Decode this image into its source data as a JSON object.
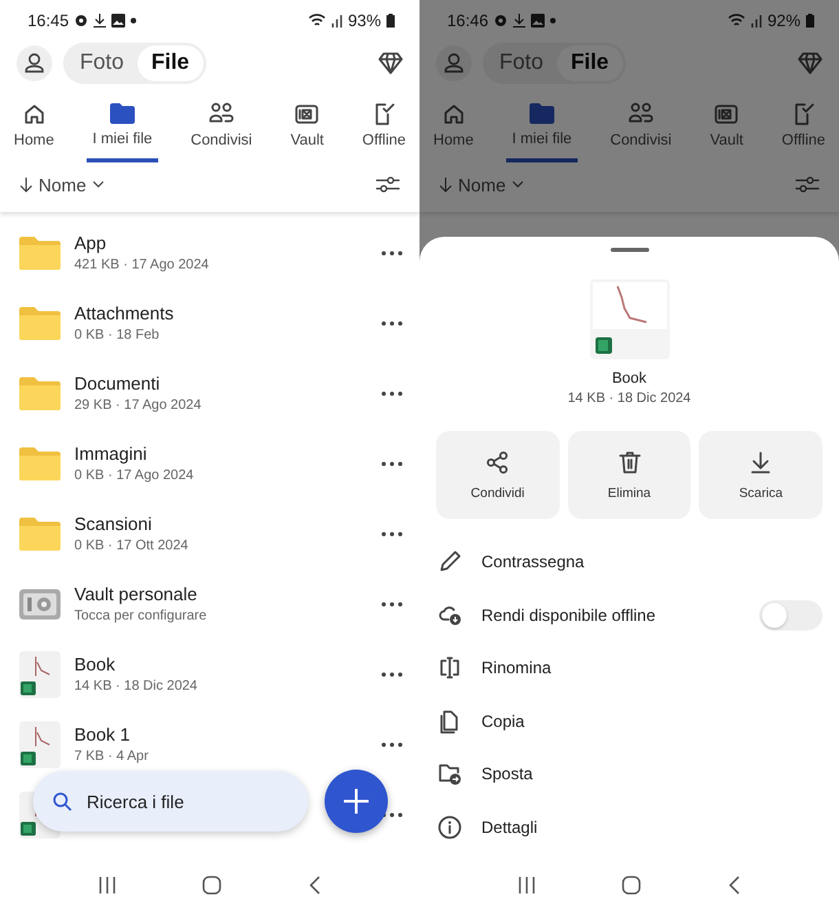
{
  "screens": [
    {
      "status": {
        "time": "16:45",
        "battery": "93%"
      },
      "segments": [
        {
          "label": "Foto",
          "selected": false
        },
        {
          "label": "File",
          "selected": true
        }
      ],
      "tabs": [
        {
          "label": "Home",
          "kind": "home",
          "selected": false
        },
        {
          "label": "I miei file",
          "kind": "folder",
          "selected": true
        },
        {
          "label": "Condivisi",
          "kind": "people",
          "selected": false
        },
        {
          "label": "Vault",
          "kind": "vault",
          "selected": false
        },
        {
          "label": "Offline",
          "kind": "offline",
          "selected": false
        }
      ],
      "sort": "Nome",
      "rows": [
        {
          "kind": "folder",
          "name": "App",
          "meta": "421 KB · 17 Ago 2024"
        },
        {
          "kind": "folder",
          "name": "Attachments",
          "meta": "0 KB · 18 Feb"
        },
        {
          "kind": "folder",
          "name": "Documenti",
          "meta": "29 KB · 17 Ago 2024"
        },
        {
          "kind": "folder",
          "name": "Immagini",
          "meta": "0 KB · 17 Ago 2024"
        },
        {
          "kind": "folder",
          "name": "Scansioni",
          "meta": "0 KB · 17 Ott 2024"
        },
        {
          "kind": "vault",
          "name": "Vault personale",
          "meta": "Tocca per configurare"
        },
        {
          "kind": "sheet",
          "name": "Book",
          "meta": "14 KB · 18 Dic 2024"
        },
        {
          "kind": "sheet",
          "name": "Book 1",
          "meta": "7 KB · 4 Apr"
        },
        {
          "kind": "sheet"
        }
      ],
      "search": {
        "placeholder": "Ricerca i file"
      }
    },
    {
      "status": {
        "time": "16:46",
        "battery": "92%"
      },
      "segments": [
        {
          "label": "Foto",
          "selected": false
        },
        {
          "label": "File",
          "selected": true
        }
      ],
      "tabs": [
        {
          "label": "Home",
          "kind": "home",
          "selected": false
        },
        {
          "label": "I miei file",
          "kind": "folder",
          "selected": true
        },
        {
          "label": "Condivisi",
          "kind": "people",
          "selected": false
        },
        {
          "label": "Vault",
          "kind": "vault",
          "selected": false
        },
        {
          "label": "Offline",
          "kind": "offline",
          "selected": false
        }
      ],
      "sort": "Nome",
      "sheet": {
        "name": "Book",
        "meta": "14 KB · 18 Dic 2024",
        "actions": [
          {
            "kind": "share",
            "label": "Condividi"
          },
          {
            "kind": "delete",
            "label": "Elimina"
          },
          {
            "kind": "download",
            "label": "Scarica"
          }
        ],
        "items": [
          {
            "kind": "flag",
            "label": "Contrassegna"
          },
          {
            "kind": "offline",
            "label": "Rendi disponibile offline",
            "on": false
          },
          {
            "kind": "rename",
            "label": "Rinomina"
          },
          {
            "kind": "copy",
            "label": "Copia"
          },
          {
            "kind": "move",
            "label": "Sposta"
          },
          {
            "kind": "details",
            "label": "Dettagli"
          }
        ]
      }
    }
  ]
}
